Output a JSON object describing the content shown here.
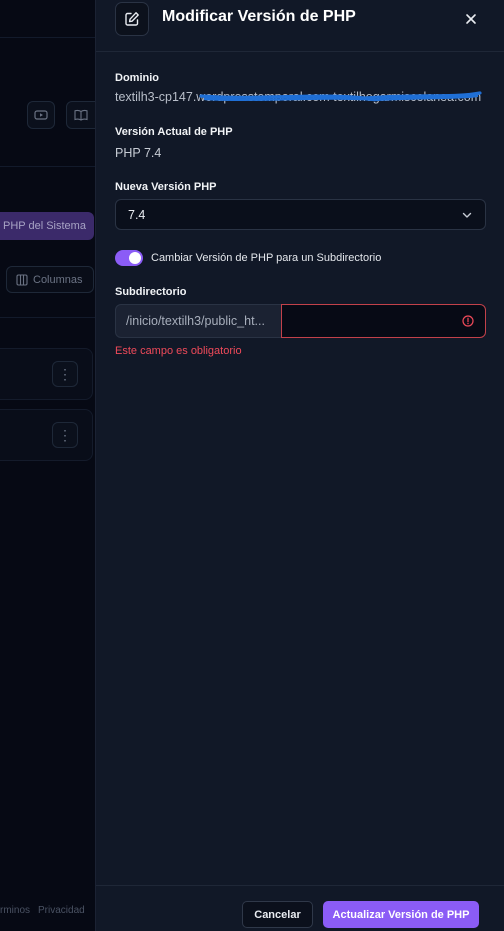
{
  "background": {
    "php_button_label": "PHP del Sistema",
    "columns_button_label": "Columnas",
    "footer_links": [
      "rminos",
      "Privacidad"
    ],
    "kebab_glyph": "⋮"
  },
  "modal": {
    "title": "Modificar Versión de PHP",
    "header_icon": "edit-icon",
    "close_icon": "close-icon",
    "domain": {
      "label": "Dominio",
      "value": "textilh3-cp147.wordpresstemporal.com textilhogarmiscelanea.com"
    },
    "current_php": {
      "label": "Versión Actual de PHP",
      "value": "PHP 7.4"
    },
    "new_php": {
      "label": "Nueva Versión PHP",
      "selected": "7.4"
    },
    "subdir_toggle": {
      "label": "Cambiar Versión de PHP para un Subdirectorio",
      "on": true
    },
    "subdirectory": {
      "label": "Subdirectorio",
      "prefix": "/inicio/textilh3/public_ht...",
      "value": "",
      "error": "Este campo es obligatorio"
    },
    "footer": {
      "cancel_label": "Cancelar",
      "submit_label": "Actualizar Versión de PHP"
    }
  },
  "colors": {
    "accent": "#8b5cf6",
    "error": "#ef4a5a",
    "drawer_bg": "#111827",
    "scribble": "#1f6fd6"
  }
}
